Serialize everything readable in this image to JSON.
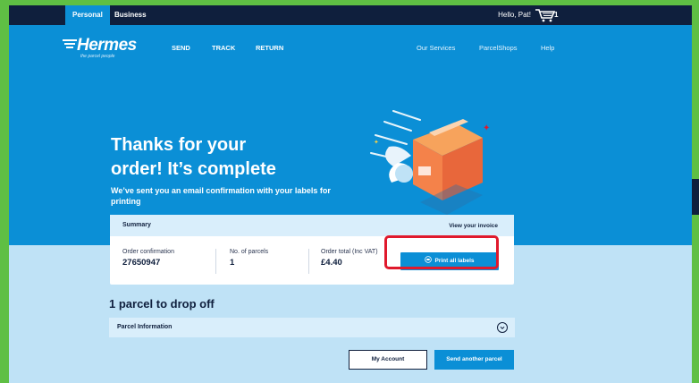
{
  "topbar": {
    "tabs": [
      {
        "label": "Personal",
        "active": true
      },
      {
        "label": "Business",
        "active": false
      }
    ],
    "greeting": "Hello, Pat!",
    "cart_count": "1",
    "cart_icon": "cart-icon"
  },
  "brand": {
    "name": "Hermes",
    "tagline": "the parcel people"
  },
  "nav": {
    "primary": [
      {
        "label": "SEND"
      },
      {
        "label": "TRACK"
      },
      {
        "label": "RETURN"
      }
    ],
    "secondary": [
      {
        "label": "Our Services"
      },
      {
        "label": "ParcelShops"
      },
      {
        "label": "Help"
      }
    ]
  },
  "hero": {
    "title_line1": "Thanks for your",
    "title_line2": "order! It’s complete",
    "subtitle": "We’ve sent you an email confirmation with your labels for printing"
  },
  "summary": {
    "heading": "Summary",
    "invoice_link": "View your invoice",
    "order_confirmation_label": "Order confirmation",
    "order_confirmation_value": "27650947",
    "parcels_label": "No. of parcels",
    "parcels_value": "1",
    "total_label": "Order total (Inc VAT)",
    "total_value": "£4.40",
    "print_button": "Print all labels"
  },
  "parcels": {
    "heading": "1 parcel to drop off",
    "info_label": "Parcel Information"
  },
  "actions": {
    "my_account": "My Account",
    "send_another": "Send another parcel"
  },
  "colors": {
    "brand_blue": "#0b8fd6",
    "navy": "#0f1f3d",
    "highlight": "#e0192c",
    "frame": "#5fbf44"
  }
}
